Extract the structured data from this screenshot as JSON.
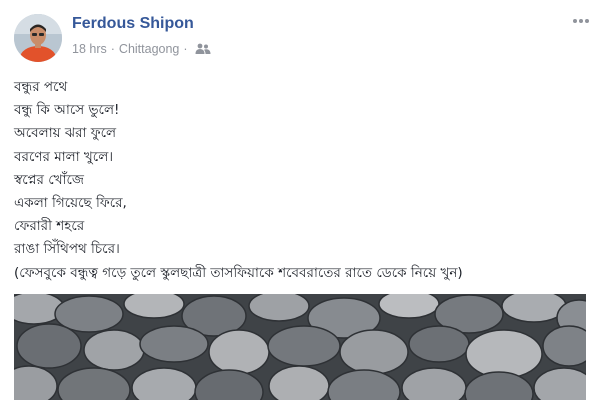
{
  "post": {
    "author_name": "Ferdous Shipon",
    "time": "18 hrs",
    "separator": "·",
    "location": "Chittagong",
    "privacy_icon": "friends-icon",
    "more_icon": "more-options-icon",
    "lines": [
      "বন্ধুর পথে",
      "বন্ধু কি আসে ভুলে!",
      "অবেলায় ঝরা ফুলে",
      "বরণের মালা খুলে।",
      "স্বপ্নের খোঁজে",
      "একলা গিয়েছে ফিরে,",
      "ফেরারী শহরে",
      "রাঙা সিঁথিপথ চিরে।",
      "(ফেসবুকে বন্ধুত্ব গড়ে তুলে স্কুলছাত্রী তাসফিয়াকে শবেবরাতের রাতে ডেকে নিয়ে খুন)"
    ]
  },
  "colors": {
    "author_link": "#365899",
    "meta_gray": "#90949c",
    "text": "#1d2129"
  }
}
